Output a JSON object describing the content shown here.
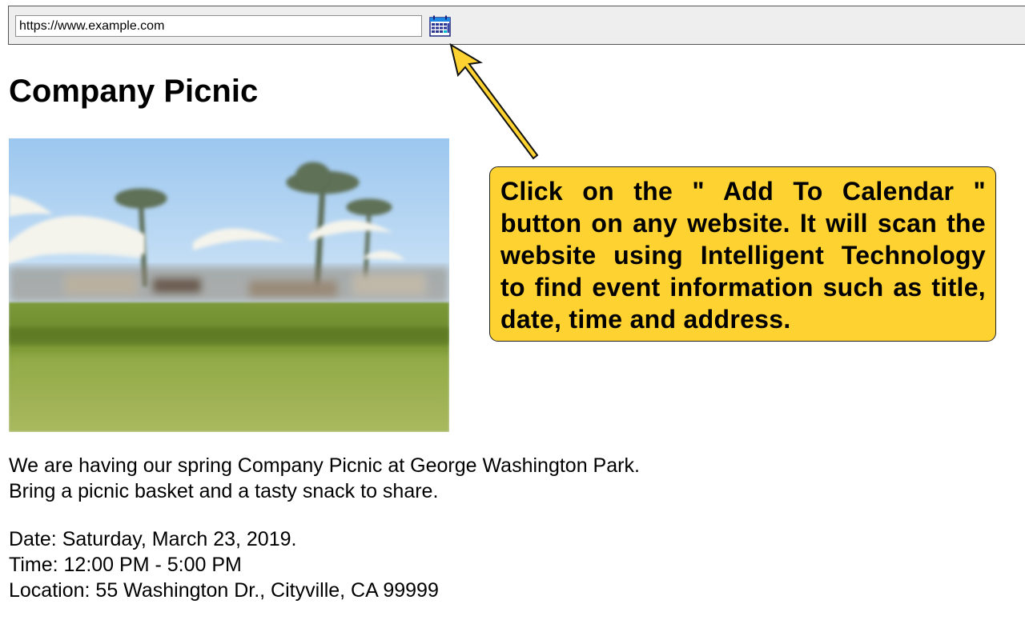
{
  "browser": {
    "url": "https://www.example.com",
    "calendar_button_icon": "calendar-icon"
  },
  "event": {
    "title": "Company Picnic",
    "description": "We are having our spring Company Picnic at George Washington Park. Bring a picnic basket and a tasty snack to share.",
    "date_line": "Date: Saturday, March 23, 2019.",
    "time_line": "Time: 12:00 PM - 5:00 PM",
    "location_line": "Location: 55 Washington Dr., Cityville, CA 99999"
  },
  "callout": {
    "text": "Click on the \" Add To Calendar \" button on any website. It will scan the website using Intelligent Technology to find event information such as title, date, time and address."
  },
  "colors": {
    "callout_background": "#fdd231",
    "arrow_fill": "#fdd231"
  }
}
